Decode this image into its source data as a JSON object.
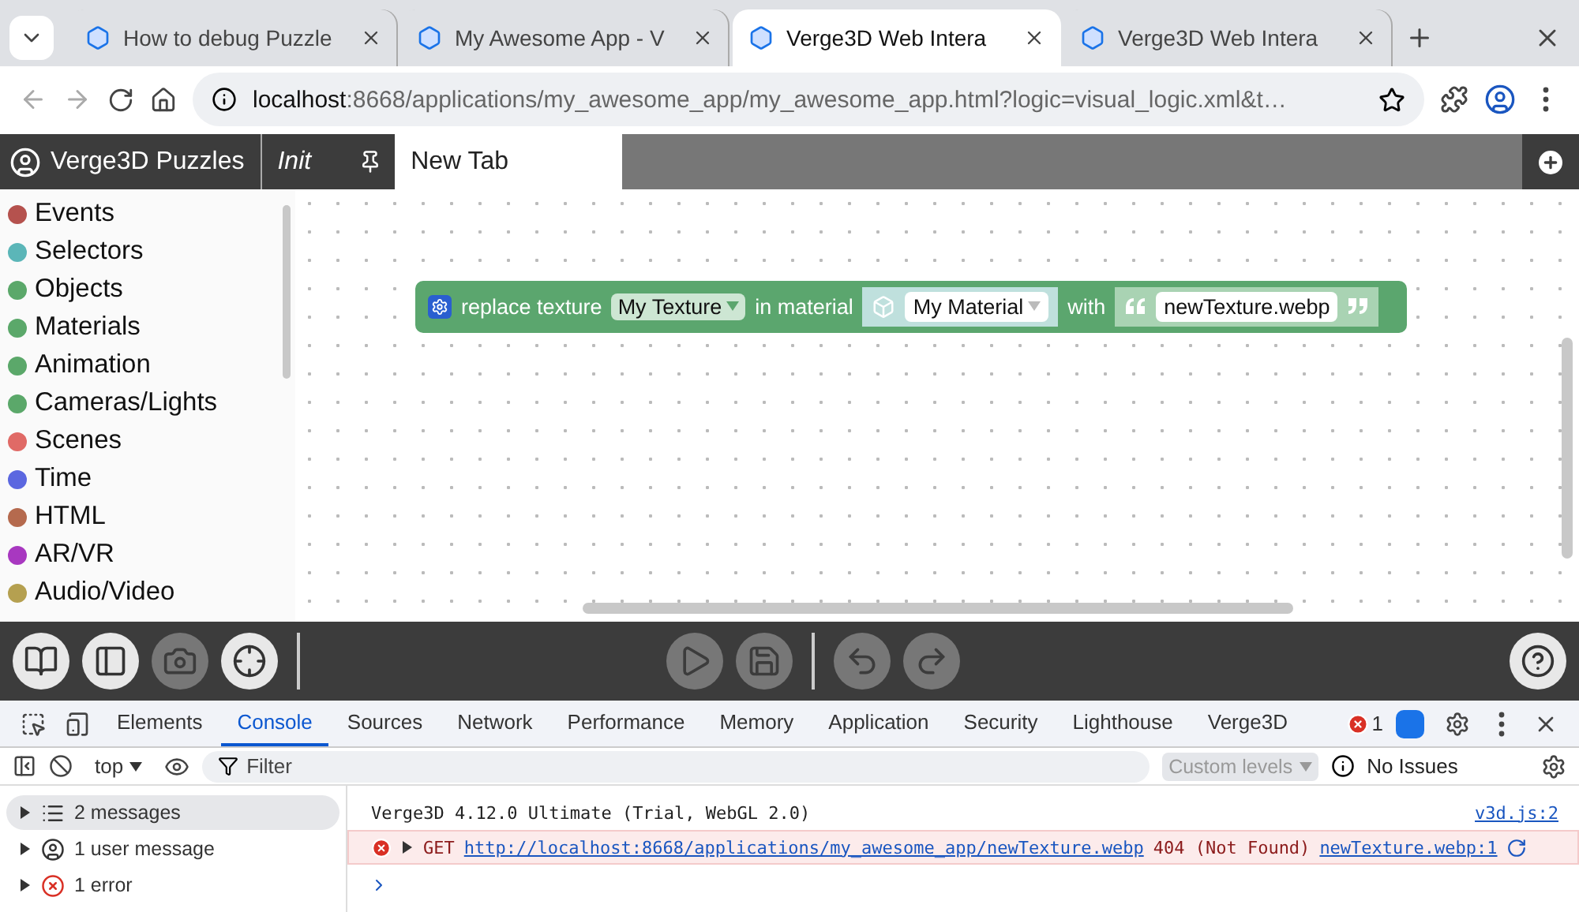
{
  "browser_tabs": [
    {
      "title": "How to debug Puzzle",
      "selected": false
    },
    {
      "title": "My Awesome App - V",
      "selected": false
    },
    {
      "title": "Verge3D Web Intera",
      "selected": true
    },
    {
      "title": "Verge3D Web Intera",
      "selected": false
    }
  ],
  "address_bar": {
    "host": "localhost",
    "rest": ":8668/applications/my_awesome_app/my_awesome_app.html?logic=visual_logic.xml&t…"
  },
  "app_header": {
    "title": "Verge3D Puzzles",
    "tabs": [
      {
        "label": "Init",
        "selected": false,
        "italic": true
      },
      {
        "label": "New Tab",
        "selected": true,
        "italic": false
      }
    ]
  },
  "categories": [
    {
      "name": "Events",
      "color": "#b5524e"
    },
    {
      "name": "Selectors",
      "color": "#5bb6b8"
    },
    {
      "name": "Objects",
      "color": "#5ba86a"
    },
    {
      "name": "Materials",
      "color": "#5ba86a"
    },
    {
      "name": "Animation",
      "color": "#5ba86a"
    },
    {
      "name": "Cameras/Lights",
      "color": "#5ba86a"
    },
    {
      "name": "Scenes",
      "color": "#e06a66"
    },
    {
      "name": "Time",
      "color": "#5b67e0"
    },
    {
      "name": "HTML",
      "color": "#b56a4e"
    },
    {
      "name": "AR/VR",
      "color": "#a838c0"
    },
    {
      "name": "Audio/Video",
      "color": "#b5a050"
    }
  ],
  "block": {
    "parts": [
      {
        "kind": "label",
        "text": "replace texture"
      },
      {
        "kind": "dropdown",
        "text": "My Texture"
      },
      {
        "kind": "label",
        "text": "in material"
      },
      {
        "kind": "material",
        "text": "My Material"
      },
      {
        "kind": "label",
        "text": "with"
      },
      {
        "kind": "string",
        "text": "newTexture.webp"
      }
    ]
  },
  "toolbar": [
    {
      "kind": "book",
      "disabled": false
    },
    {
      "kind": "panel",
      "disabled": false
    },
    {
      "kind": "camera",
      "disabled": true
    },
    {
      "kind": "target",
      "disabled": false
    },
    {
      "kind": "sep",
      "disabled": false
    },
    {
      "kind": "play",
      "disabled": true
    },
    {
      "kind": "save",
      "disabled": true
    },
    {
      "kind": "sep",
      "disabled": false
    },
    {
      "kind": "undo",
      "disabled": true
    },
    {
      "kind": "redo",
      "disabled": true
    },
    {
      "kind": "help",
      "disabled": false
    }
  ],
  "devtools": {
    "tabs": [
      {
        "label": "Elements",
        "selected": false
      },
      {
        "label": "Console",
        "selected": true
      },
      {
        "label": "Sources",
        "selected": false
      },
      {
        "label": "Network",
        "selected": false
      },
      {
        "label": "Performance",
        "selected": false
      },
      {
        "label": "Memory",
        "selected": false
      },
      {
        "label": "Application",
        "selected": false
      },
      {
        "label": "Security",
        "selected": false
      },
      {
        "label": "Lighthouse",
        "selected": false
      },
      {
        "label": "Verge3D",
        "selected": false
      }
    ],
    "error_count": "1",
    "context": "top",
    "filter_placeholder": "Filter",
    "levels": "Custom levels",
    "issues": "No Issues",
    "groups": [
      {
        "kind": "list",
        "label": "2 messages",
        "selected": true
      },
      {
        "kind": "user",
        "label": "1 user message",
        "selected": false
      },
      {
        "kind": "error",
        "label": "1 error",
        "selected": false
      }
    ],
    "messages": [
      {
        "kind": "info",
        "text": "Verge3D 4.12.0 Ultimate (Trial, WebGL 2.0)",
        "source": "v3d.js:2"
      },
      {
        "kind": "error",
        "method": "GET",
        "url": "http://localhost:8668/applications/my_awesome_app/newTexture.webp",
        "status": "404 (Not Found)",
        "source": "newTexture.webp:1"
      }
    ]
  }
}
